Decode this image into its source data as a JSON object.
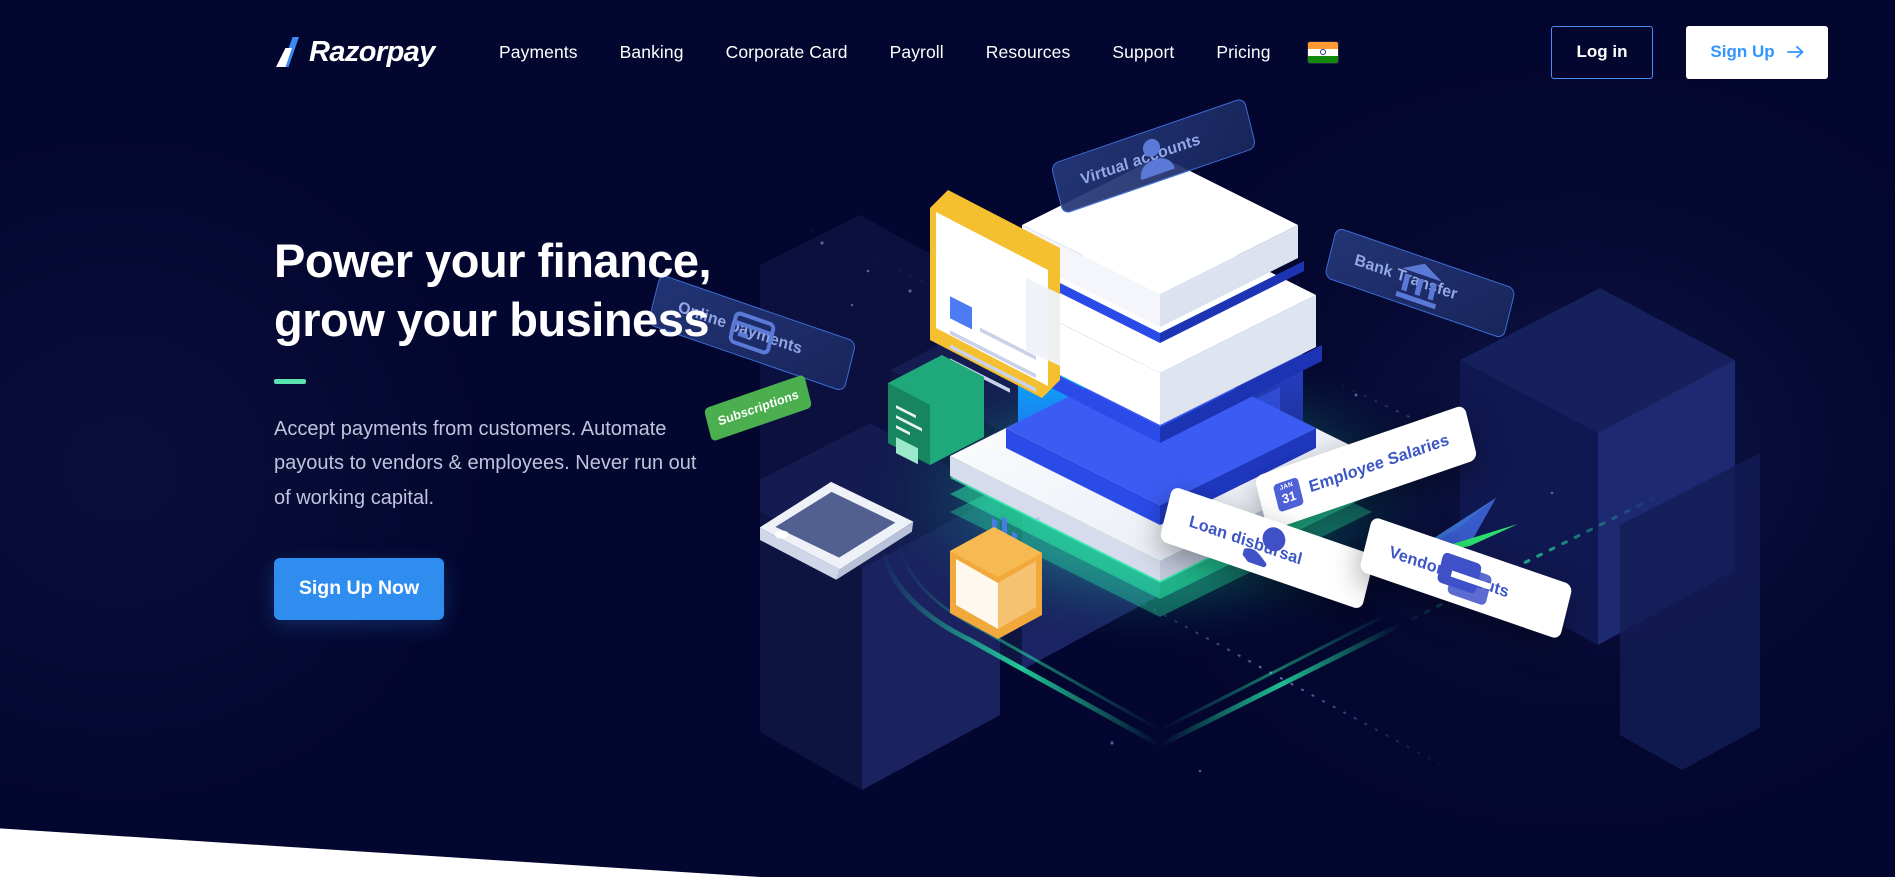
{
  "brand": {
    "name": "Razorpay",
    "logo_icon": "razorpay-logo-icon"
  },
  "header": {
    "nav_items": [
      {
        "label": "Payments",
        "name": "nav-item-payments"
      },
      {
        "label": "Banking",
        "name": "nav-item-banking"
      },
      {
        "label": "Corporate Card",
        "name": "nav-item-corporate-card"
      },
      {
        "label": "Payroll",
        "name": "nav-item-payroll"
      },
      {
        "label": "Resources",
        "name": "nav-item-resources"
      },
      {
        "label": "Support",
        "name": "nav-item-support"
      },
      {
        "label": "Pricing",
        "name": "nav-item-pricing"
      }
    ],
    "locale_flag": "india-flag-icon",
    "login_label": "Log in",
    "signup_label": "Sign Up",
    "signup_arrow_icon": "arrow-right-icon"
  },
  "hero": {
    "title": "Power your finance,\ngrow your business",
    "accent_color": "#5BE3B0",
    "subtitle": "Accept payments from customers. Automate\npayouts to vendors & employees. Never run out\nof working capital.",
    "cta_label": "Sign Up Now",
    "cta_color": "#2E8DEF"
  },
  "illustration": {
    "name": "isometric-finance-platform-illustration",
    "labels": [
      {
        "text": "Virtual accounts",
        "icon": "user-icon",
        "style": "dark"
      },
      {
        "text": "Online payments",
        "icon": "credit-card-icon",
        "style": "dark"
      },
      {
        "text": "Bank Transfer",
        "icon": "bank-icon",
        "style": "dark"
      },
      {
        "text": "Employee Salaries",
        "icon": "calendar-icon",
        "style": "white"
      },
      {
        "text": "Loan disbursal",
        "icon": "hand-coin-icon",
        "style": "white"
      },
      {
        "text": "Vendor Payouts",
        "icon": "card-stack-icon",
        "style": "white"
      },
      {
        "text": "Subscriptions",
        "icon": "speech-bubble-icon",
        "style": "green"
      }
    ],
    "calendar_badge": {
      "month": "JAN",
      "day": "31"
    },
    "accent_glow_color": "#25E8A8",
    "paper_plane_icon": "paper-plane-icon"
  },
  "colors": {
    "background": "#03062E",
    "primary_blue": "#2E8DEF",
    "link_blue": "#3395FF",
    "mint": "#5BE3B0",
    "text_muted": "#BFC3DB"
  }
}
